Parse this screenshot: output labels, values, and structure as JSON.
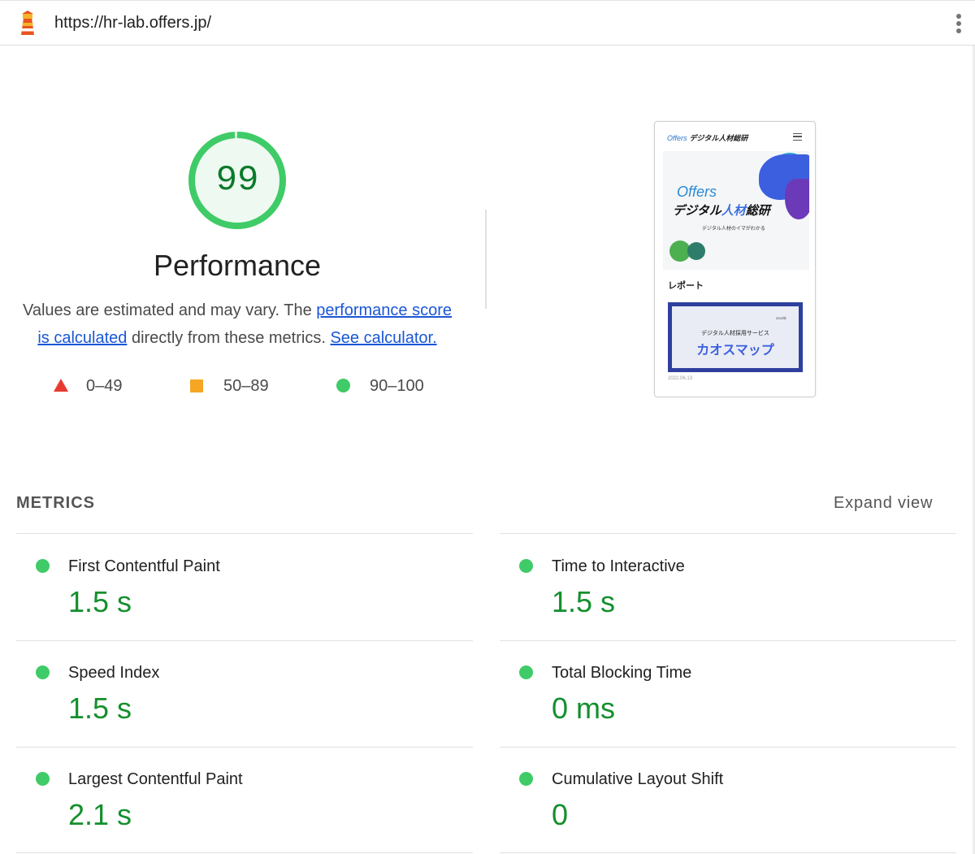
{
  "header": {
    "url": "https://hr-lab.offers.jp/",
    "logo_icon": "lighthouse-icon",
    "menu_icon": "kebab-menu-icon"
  },
  "gauge": {
    "score": "99",
    "fraction": 0.99,
    "color": "#3fcb67"
  },
  "category_title": "Performance",
  "description": {
    "text_before": "Values are estimated and may vary. The ",
    "link_score": "performance score is calculated",
    "text_middle": " directly from these metrics. ",
    "link_calculator": "See calculator."
  },
  "legend": [
    {
      "icon": "triangle-icon",
      "label": "0–49",
      "color": "#e83b30"
    },
    {
      "icon": "square-icon",
      "label": "50–89",
      "color": "#f5a623"
    },
    {
      "icon": "circle-icon",
      "label": "90–100",
      "color": "#3fcb67"
    }
  ],
  "screenshot": {
    "brand": "Offers",
    "brand_suffix": "デジタル人材総研",
    "hero_title": "Offers",
    "hero_heading_a": "デジタル",
    "hero_heading_b": "人材",
    "hero_heading_c": "総研",
    "hero_sub": "デジタル人材のイマがわかる",
    "section": "レポート",
    "card_year": "2022年",
    "card_sub": "デジタル人材採用サービス",
    "card_title": "カオスマップ",
    "date": "2022.06.13"
  },
  "metrics": {
    "heading": "METRICS",
    "expand_label": "Expand view",
    "items": [
      {
        "label": "First Contentful Paint",
        "value": "1.5 s"
      },
      {
        "label": "Time to Interactive",
        "value": "1.5 s"
      },
      {
        "label": "Speed Index",
        "value": "1.5 s"
      },
      {
        "label": "Total Blocking Time",
        "value": "0 ms"
      },
      {
        "label": "Largest Contentful Paint",
        "value": "2.1 s"
      },
      {
        "label": "Cumulative Layout Shift",
        "value": "0"
      }
    ]
  }
}
